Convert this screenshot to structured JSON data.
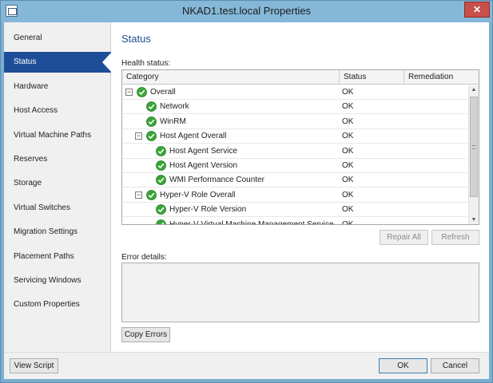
{
  "window": {
    "title": "NKAD1.test.local Properties",
    "close_glyph": "✕"
  },
  "nav": {
    "items": [
      {
        "label": "General",
        "selected": false
      },
      {
        "label": "Status",
        "selected": true
      },
      {
        "label": "Hardware",
        "selected": false
      },
      {
        "label": "Host Access",
        "selected": false
      },
      {
        "label": "Virtual Machine Paths",
        "selected": false
      },
      {
        "label": "Reserves",
        "selected": false
      },
      {
        "label": "Storage",
        "selected": false
      },
      {
        "label": "Virtual Switches",
        "selected": false
      },
      {
        "label": "Migration Settings",
        "selected": false
      },
      {
        "label": "Placement Paths",
        "selected": false
      },
      {
        "label": "Servicing Windows",
        "selected": false
      },
      {
        "label": "Custom Properties",
        "selected": false
      }
    ]
  },
  "status_page": {
    "title": "Status",
    "health_label": "Health status:",
    "columns": [
      "Category",
      "Status",
      "Remediation"
    ],
    "rows": [
      {
        "category": "Overall",
        "status": "OK",
        "level": 0,
        "expander": "⊟"
      },
      {
        "category": "Network",
        "status": "OK",
        "level": 1,
        "expander": ""
      },
      {
        "category": "WinRM",
        "status": "OK",
        "level": 1,
        "expander": ""
      },
      {
        "category": "Host Agent Overall",
        "status": "OK",
        "level": 1,
        "expander": "⊟"
      },
      {
        "category": "Host Agent Service",
        "status": "OK",
        "level": 2,
        "expander": ""
      },
      {
        "category": "Host Agent Version",
        "status": "OK",
        "level": 2,
        "expander": ""
      },
      {
        "category": "WMI Performance Counter",
        "status": "OK",
        "level": 2,
        "expander": ""
      },
      {
        "category": "Hyper-V Role Overall",
        "status": "OK",
        "level": 1,
        "expander": "⊟"
      },
      {
        "category": "Hyper-V Role Version",
        "status": "OK",
        "level": 2,
        "expander": ""
      },
      {
        "category": "Hyper-V Virtual Machine Management Service",
        "status": "OK",
        "level": 2,
        "expander": ""
      }
    ],
    "repair_all_label": "Repair All",
    "refresh_label": "Refresh",
    "error_label": "Error details:",
    "error_text": "",
    "copy_errors_label": "Copy Errors"
  },
  "footer": {
    "view_script_label": "View Script",
    "ok_label": "OK",
    "cancel_label": "Cancel"
  },
  "colors": {
    "titlebar": "#85b8d8",
    "nav_selected": "#1f4e98",
    "ok_green": "#3aa537",
    "page_title": "#1c4e8c"
  },
  "icons": {
    "ok": "ok-check-icon",
    "expander": "collapse-icon"
  }
}
